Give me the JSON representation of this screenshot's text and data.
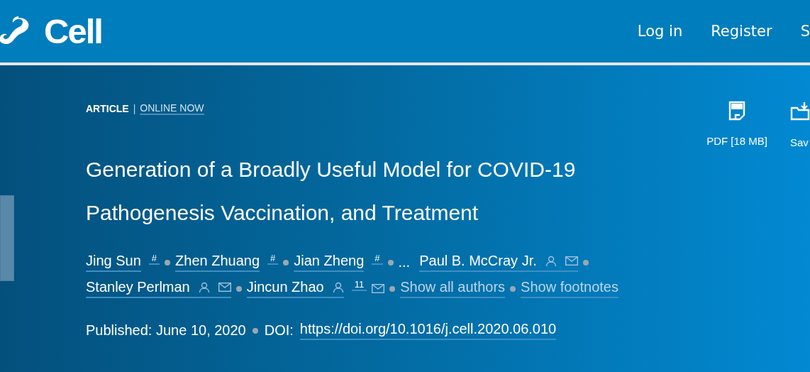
{
  "header": {
    "logo_text": "Cell",
    "nav": [
      "Log in",
      "Register",
      "S"
    ]
  },
  "article": {
    "type": "ARTICLE",
    "separator": "|",
    "status": "ONLINE NOW",
    "title": "Generation of a Broadly Useful Model for COVID-19 Pathogenesis Vaccination, and Treatment",
    "actions": [
      {
        "kind": "pdf",
        "label": "PDF [18 MB]"
      },
      {
        "kind": "save",
        "label": "Sav"
      }
    ],
    "authors": [
      {
        "kind": "author",
        "name": "Jing Sun",
        "note": "#",
        "profile": false,
        "email": false
      },
      {
        "kind": "author",
        "name": "Zhen Zhuang",
        "note": "#",
        "profile": false,
        "email": false
      },
      {
        "kind": "author",
        "name": "Jian Zheng",
        "note": "#",
        "profile": false,
        "email": false
      },
      {
        "kind": "ellipsis",
        "name": "..."
      },
      {
        "kind": "author",
        "name": "Paul B. McCray Jr.",
        "profile": true,
        "email": true
      },
      {
        "kind": "author",
        "name": "Stanley Perlman",
        "profile": true,
        "email": true
      },
      {
        "kind": "author",
        "name": "Jincun Zhao",
        "note": "11",
        "profile": true,
        "email": true
      }
    ],
    "author_links": [
      "Show all authors",
      "Show footnotes"
    ],
    "published": "Published: June 10, 2020",
    "doi_label": "DOI:",
    "doi": "https://doi.org/10.1016/j.cell.2020.06.010"
  }
}
